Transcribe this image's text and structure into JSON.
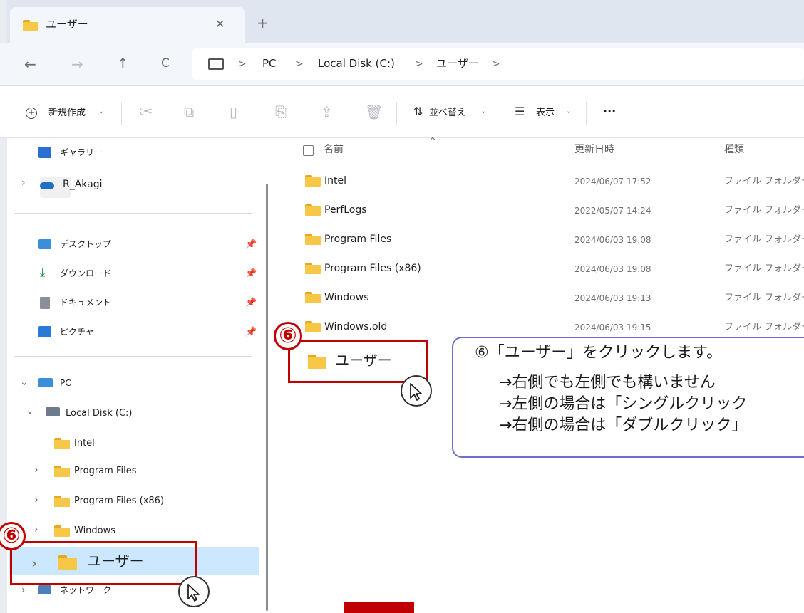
{
  "tab": {
    "title": "ユーザー",
    "close": "✕",
    "new": "+"
  },
  "nav": {
    "back": "←",
    "forward": "→",
    "up": "↑",
    "refresh": "C",
    "breadcrumb": [
      "PC",
      "Local Disk (C:)",
      "ユーザー"
    ],
    "sep": ">"
  },
  "toolbar": {
    "new_label": "新規作成",
    "sort_label": "並べ替え",
    "view_label": "表示",
    "more": "···"
  },
  "sidebar": {
    "gallery": "ギャラリー",
    "cloud": "R_Akagi",
    "quick": [
      "デスクトップ",
      "ダウンロード",
      "ドキュメント",
      "ピクチャ"
    ],
    "pc": "PC",
    "disk": "Local Disk (C:)",
    "folders": [
      "Intel",
      "Program Files",
      "Program Files (x86)",
      "Windows"
    ],
    "selected": "ユーザー",
    "network": "ネットワーク"
  },
  "columns": {
    "name": "名前",
    "date": "更新日時",
    "type": "種類"
  },
  "files": [
    {
      "name": "Intel",
      "date": "2024/06/07 17:52",
      "type": "ファイル フォルダー"
    },
    {
      "name": "PerfLogs",
      "date": "2022/05/07 14:24",
      "type": "ファイル フォルダー"
    },
    {
      "name": "Program Files",
      "date": "2024/06/03 19:08",
      "type": "ファイル フォルダー"
    },
    {
      "name": "Program Files (x86)",
      "date": "2024/06/03 19:08",
      "type": "ファイル フォルダー"
    },
    {
      "name": "Windows",
      "date": "2024/06/03 19:13",
      "type": "ファイル フォルダー"
    },
    {
      "name": "Windows.old",
      "date": "2024/06/03 19:15",
      "type": "ファイル フォルダー"
    }
  ],
  "highlight_folder": "ユーザー",
  "annotation": {
    "step": "⑥",
    "lines": [
      "⑥「ユーザー」をクリックします。",
      "→右側でも左側でも構いません",
      "→左側の場合は「シングルクリック",
      "→右側の場合は「ダブルクリック」"
    ]
  },
  "colors": {
    "accent_red": "#c00000",
    "callout_border": "#6d6fd0",
    "folder": "#f7c847",
    "selection": "#cce8ff"
  }
}
